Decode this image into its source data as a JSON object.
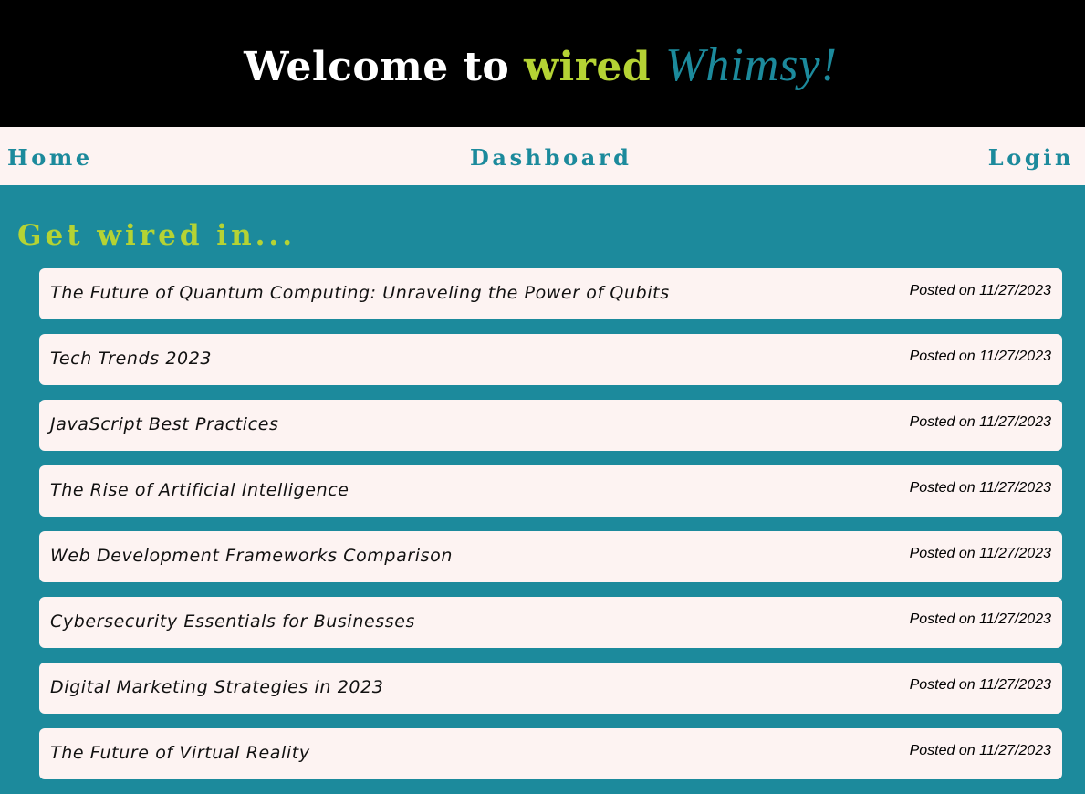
{
  "header": {
    "title_prefix": "Welcome to ",
    "title_wired": "wired",
    "title_whimsy": "Whimsy!"
  },
  "nav": {
    "home": "Home",
    "dashboard": "Dashboard",
    "login": "Login"
  },
  "main": {
    "heading": "Get wired in...",
    "posts": [
      {
        "title": "The Future of Quantum Computing: Unraveling the Power of Qubits",
        "date": "Posted on 11/27/2023"
      },
      {
        "title": "Tech Trends 2023",
        "date": "Posted on 11/27/2023"
      },
      {
        "title": "JavaScript Best Practices",
        "date": "Posted on 11/27/2023"
      },
      {
        "title": "The Rise of Artificial Intelligence",
        "date": "Posted on 11/27/2023"
      },
      {
        "title": "Web Development Frameworks Comparison",
        "date": "Posted on 11/27/2023"
      },
      {
        "title": "Cybersecurity Essentials for Businesses",
        "date": "Posted on 11/27/2023"
      },
      {
        "title": "Digital Marketing Strategies in 2023",
        "date": "Posted on 11/27/2023"
      },
      {
        "title": "The Future of Virtual Reality",
        "date": "Posted on 11/27/2023"
      }
    ]
  },
  "colors": {
    "header_bg": "#000000",
    "accent_green": "#b5d334",
    "accent_teal": "#1c8a9c",
    "card_bg": "#fdf3f2"
  }
}
